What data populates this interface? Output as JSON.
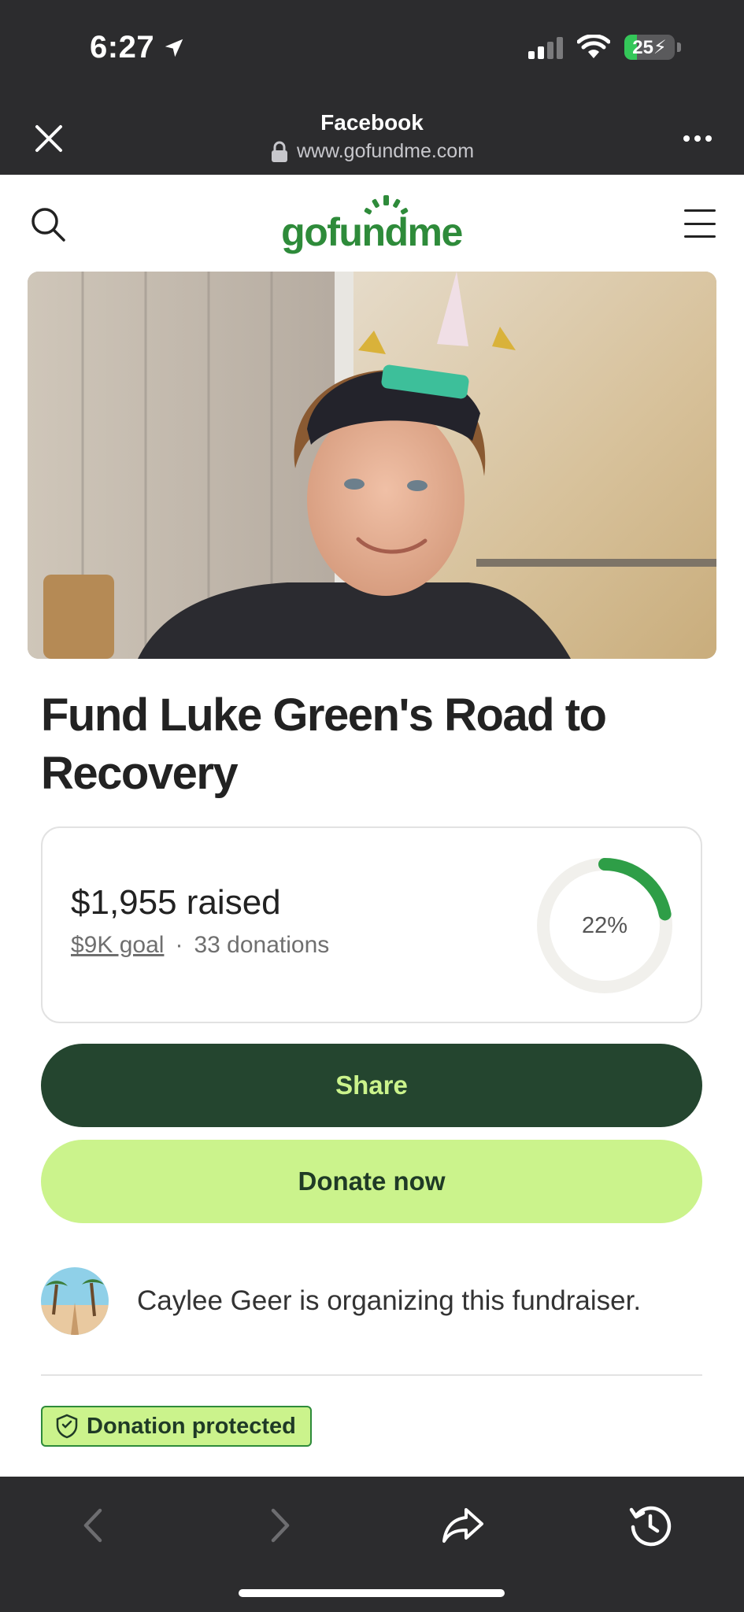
{
  "status_bar": {
    "time": "6:27",
    "battery": "25",
    "battery_level": 0.25
  },
  "browser": {
    "title": "Facebook",
    "url": "www.gofundme.com"
  },
  "site": {
    "logo_text": "gofundme"
  },
  "campaign": {
    "title": "Fund Luke Green's Road to Recovery",
    "raised": "$1,955 raised",
    "goal": "$9K goal",
    "separator": "·",
    "donations": "33 donations",
    "progress_label": "22%",
    "progress": 0.22
  },
  "actions": {
    "share": "Share",
    "donate": "Donate now"
  },
  "organizer": {
    "text": "Caylee Geer is organizing this fundraiser."
  },
  "badge": {
    "label": "Donation protected"
  },
  "colors": {
    "brand_green": "#2e8b3a",
    "dark_green": "#24452f",
    "lime": "#cbf38c",
    "browser_chrome": "#2c2c2e"
  }
}
